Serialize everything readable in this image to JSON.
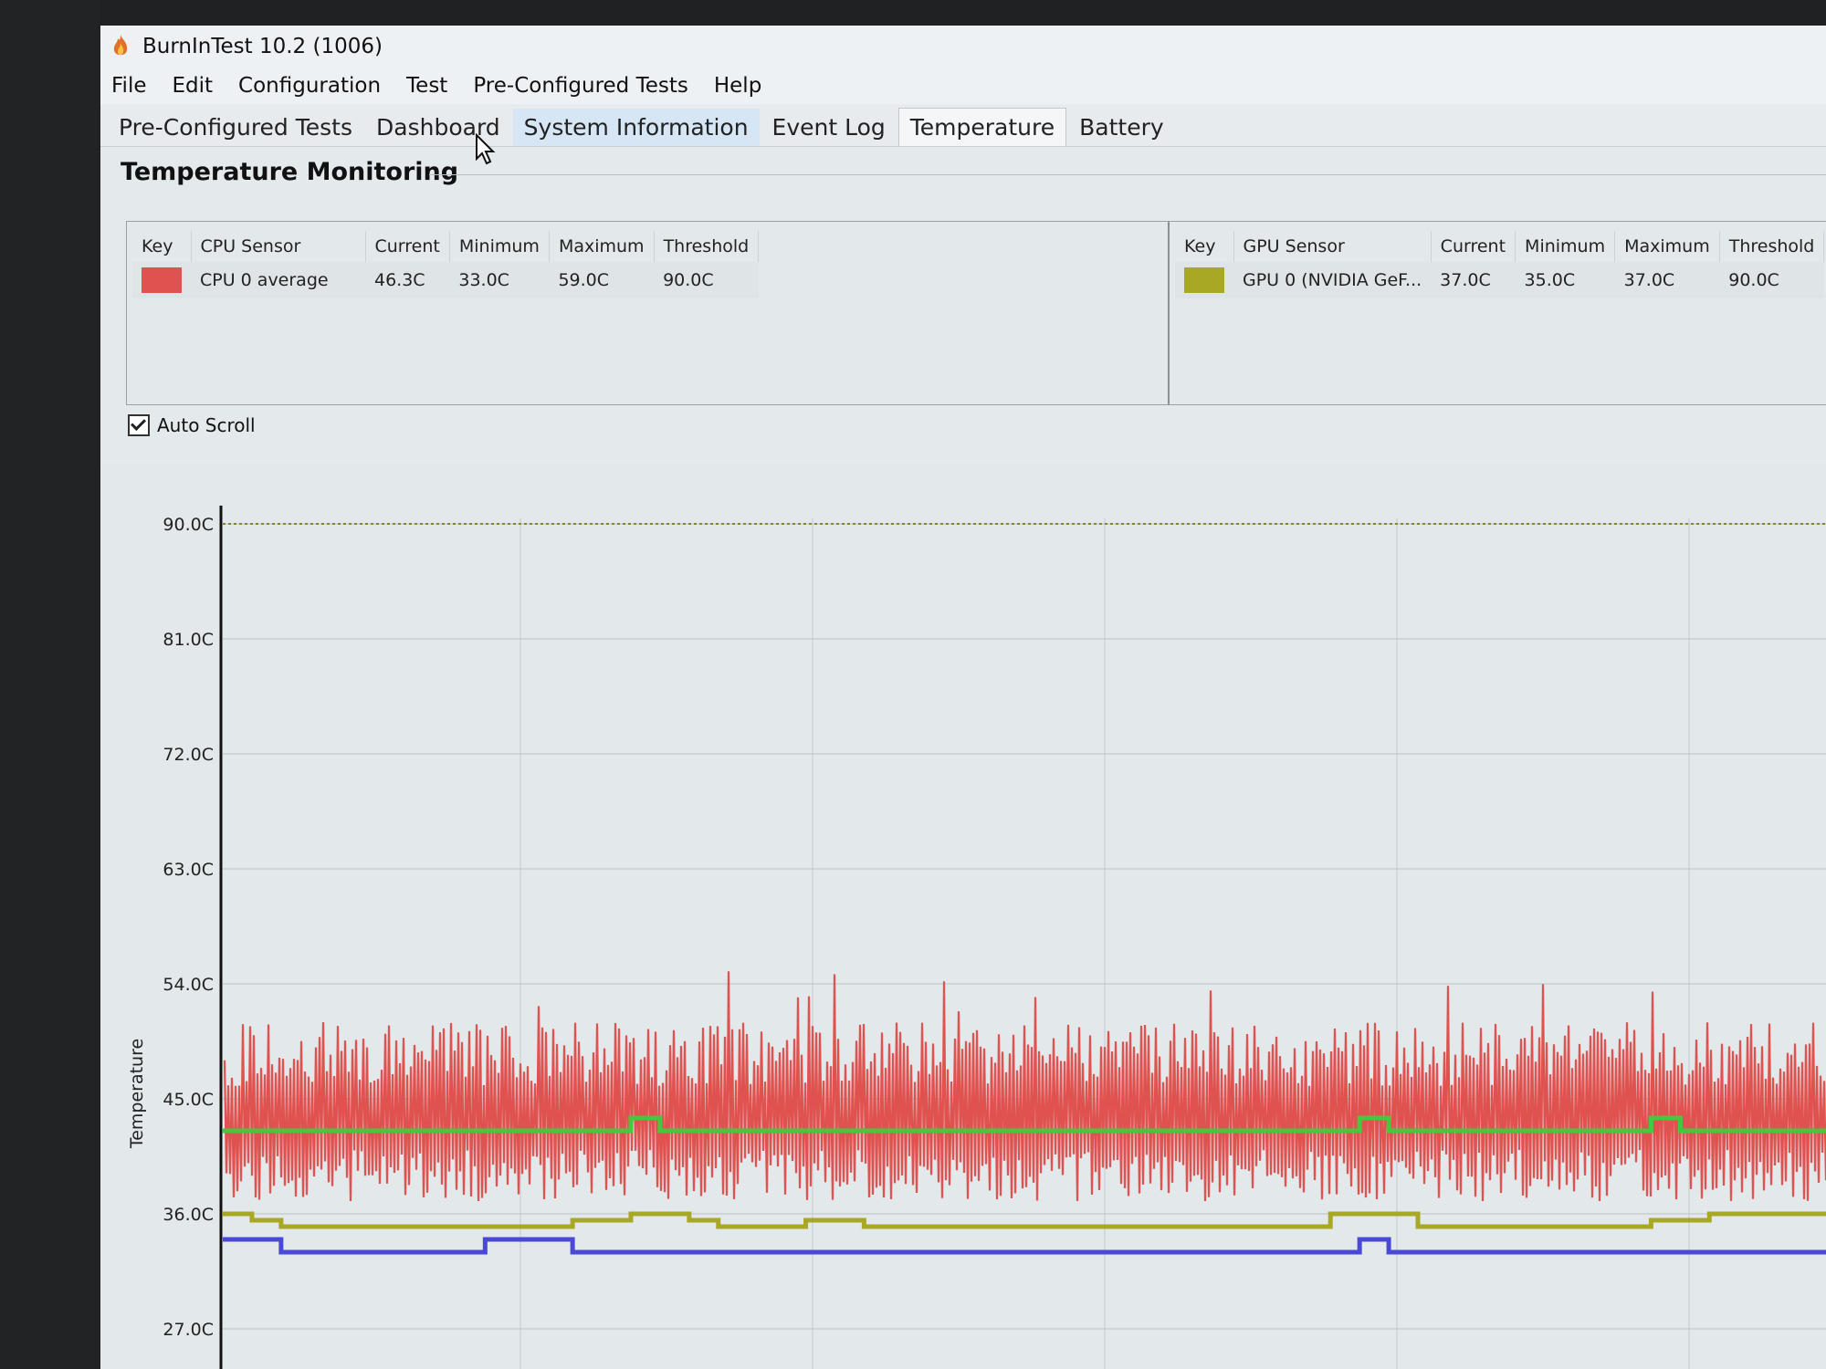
{
  "window": {
    "title": "BurnInTest 10.2 (1006)"
  },
  "menu": [
    "File",
    "Edit",
    "Configuration",
    "Test",
    "Pre-Configured Tests",
    "Help"
  ],
  "tabs": [
    "Pre-Configured Tests",
    "Dashboard",
    "System Information",
    "Event Log",
    "Temperature",
    "Battery"
  ],
  "section_title": "Temperature Monitoring",
  "cpu_table": {
    "headers": [
      "Key",
      "CPU Sensor",
      "Current",
      "Minimum",
      "Maximum",
      "Threshold"
    ],
    "row": {
      "key_color": "#e0524f",
      "sensor": "CPU 0 average",
      "current": "46.3C",
      "minimum": "33.0C",
      "maximum": "59.0C",
      "threshold": "90.0C"
    }
  },
  "gpu_table": {
    "headers": [
      "Key",
      "GPU Sensor",
      "Current",
      "Minimum",
      "Maximum",
      "Threshold"
    ],
    "row": {
      "key_color": "#a8a824",
      "sensor": "GPU 0 (NVIDIA GeF...",
      "current": "37.0C",
      "minimum": "35.0C",
      "maximum": "37.0C",
      "threshold": "90.0C"
    }
  },
  "auto_scroll": {
    "label": "Auto Scroll",
    "checked": true
  },
  "chart_data": {
    "type": "line",
    "ylabel": "Temperature",
    "yticks": [
      "90.0C",
      "81.0C",
      "72.0C",
      "63.0C",
      "54.0C",
      "45.0C",
      "36.0C",
      "27.0C"
    ],
    "ylim": [
      24,
      90
    ],
    "threshold": 90,
    "grid": true,
    "series": [
      {
        "color": "#e0524f",
        "style": "noisy",
        "low": 37,
        "high": 51,
        "peak": 55
      },
      {
        "color": "#46c83e",
        "values": [
          42.5,
          42.5,
          42.5,
          42.5,
          42.5,
          42.5,
          42.5,
          42.5,
          42.5,
          42.5,
          42.5,
          42.5,
          42.5,
          42.5,
          43.5,
          42.5,
          42.5,
          42.5,
          42.5,
          42.5,
          42.5,
          42.5,
          42.5,
          42.5,
          42.5,
          42.5,
          42.5,
          42.5,
          42.5,
          42.5,
          42.5,
          42.5,
          42.5,
          42.5,
          42.5,
          42.5,
          42.5,
          42.5,
          42.5,
          43.5,
          42.5,
          42.5,
          42.5,
          42.5,
          42.5,
          42.5,
          42.5,
          42.5,
          42.5,
          43.5,
          42.5,
          42.5,
          42.5,
          42.5,
          42.5
        ]
      },
      {
        "color": "#a8a824",
        "values": [
          36,
          35.5,
          35,
          35,
          35,
          35,
          35,
          35,
          35,
          35,
          35,
          35,
          35.5,
          35.5,
          36,
          36,
          35.5,
          35,
          35,
          35,
          35.5,
          35.5,
          35,
          35,
          35,
          35,
          35,
          35,
          35,
          35,
          35,
          35,
          35,
          35,
          35,
          35,
          35,
          35,
          36,
          36,
          36,
          35,
          35,
          35,
          35,
          35,
          35,
          35,
          35,
          35.5,
          35.5,
          36,
          36,
          36,
          36
        ]
      },
      {
        "color": "#4a48d6",
        "values": [
          34,
          34,
          33,
          33,
          33,
          33,
          33,
          33,
          33,
          34,
          34,
          34,
          33,
          33,
          33,
          33,
          33,
          33,
          33,
          33,
          33,
          33,
          33,
          33,
          33,
          33,
          33,
          33,
          33,
          33,
          33,
          33,
          33,
          33,
          33,
          33,
          33,
          33,
          33,
          34,
          33,
          33,
          33,
          33,
          33,
          33,
          33,
          33,
          33,
          33,
          33,
          33,
          33,
          33,
          33
        ]
      }
    ]
  }
}
